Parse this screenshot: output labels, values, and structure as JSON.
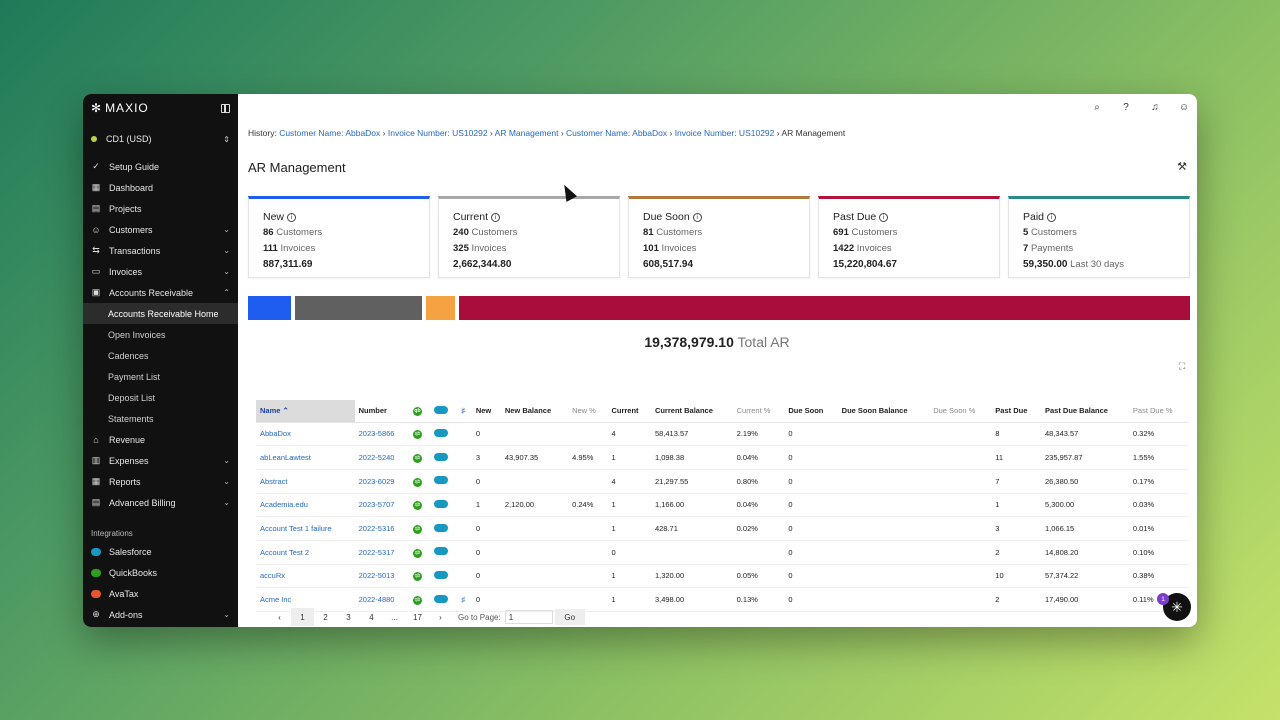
{
  "brand": {
    "name": "MAXIO"
  },
  "entity": {
    "label": "CD1 (USD)"
  },
  "nav": [
    {
      "label": "Setup Guide",
      "icon": "check-circle-icon",
      "chev": ""
    },
    {
      "label": "Dashboard",
      "icon": "dashboard-icon",
      "chev": ""
    },
    {
      "label": "Projects",
      "icon": "folder-icon",
      "chev": ""
    },
    {
      "label": "Customers",
      "icon": "users-icon",
      "chev": "⌄"
    },
    {
      "label": "Transactions",
      "icon": "transactions-icon",
      "chev": "⌄"
    },
    {
      "label": "Invoices",
      "icon": "invoice-icon",
      "chev": "⌄"
    },
    {
      "label": "Accounts Receivable",
      "icon": "wallet-icon",
      "chev": "⌃"
    }
  ],
  "ar_sub": [
    "Accounts Receivable Home",
    "Open Invoices",
    "Cadences",
    "Payment List",
    "Deposit List",
    "Statements"
  ],
  "nav2": [
    {
      "label": "Revenue",
      "icon": "bank-icon",
      "chev": ""
    },
    {
      "label": "Expenses",
      "icon": "expenses-icon",
      "chev": "⌄"
    },
    {
      "label": "Reports",
      "icon": "reports-icon",
      "chev": "⌄"
    },
    {
      "label": "Advanced Billing",
      "icon": "billing-icon",
      "chev": "⌄"
    }
  ],
  "integrations": {
    "label": "Integrations",
    "items": [
      {
        "label": "Salesforce",
        "color": "#1798c1"
      },
      {
        "label": "QuickBooks",
        "color": "#2ca01c"
      },
      {
        "label": "AvaTax",
        "color": "#e8542e"
      }
    ]
  },
  "addons": {
    "label": "Add-ons"
  },
  "history": {
    "label": "History:",
    "links": [
      "Customer Name: AbbaDox",
      "Invoice Number: US10292",
      "AR Management",
      "Customer Name: AbbaDox",
      "Invoice Number: US10292"
    ],
    "current": "AR Management"
  },
  "page": {
    "title": "AR Management"
  },
  "cards": [
    {
      "title": "New",
      "color": "#1f5cf0",
      "count1": "86",
      "label1": "Customers",
      "count2": "111",
      "label2": "Invoices",
      "amount": "887,311.69",
      "note": ""
    },
    {
      "title": "Current",
      "color": "#a8a8a8",
      "count1": "240",
      "label1": "Customers",
      "count2": "325",
      "label2": "Invoices",
      "amount": "2,662,344.80",
      "note": ""
    },
    {
      "title": "Due Soon",
      "color": "#b07a3a",
      "count1": "81",
      "label1": "Customers",
      "count2": "101",
      "label2": "Invoices",
      "amount": "608,517.94",
      "note": ""
    },
    {
      "title": "Past Due",
      "color": "#b0123a",
      "count1": "691",
      "label1": "Customers",
      "count2": "1422",
      "label2": "Invoices",
      "amount": "15,220,804.67",
      "note": ""
    },
    {
      "title": "Paid",
      "color": "#2a8a8a",
      "count1": "5",
      "label1": "Customers",
      "count2": "7",
      "label2": "Payments",
      "amount": "59,350.00",
      "note": "Last 30 days"
    }
  ],
  "bar": [
    {
      "name": "New",
      "color": "#1f5cf0",
      "share": 0.046
    },
    {
      "name": "Current",
      "color": "#606060",
      "share": 0.137
    },
    {
      "name": "Due Soon",
      "color": "#f5a342",
      "share": 0.031
    },
    {
      "name": "Past Due",
      "color": "#a80d3c",
      "share": 0.786
    }
  ],
  "total": {
    "amount": "19,378,979.10",
    "label": "Total AR"
  },
  "table": {
    "headers": [
      "Name ⌃",
      "Number",
      "",
      "",
      "",
      "New",
      "New Balance",
      "New %",
      "Current",
      "Current Balance",
      "Current %",
      "Due Soon",
      "Due Soon Balance",
      "Due Soon %",
      "Past Due",
      "Past Due Balance",
      "Past Due %"
    ],
    "rows": [
      [
        "AbbaDox",
        "2023-5866",
        "0",
        "",
        "",
        "4",
        "58,413.57",
        "2.19%",
        "0",
        "",
        "",
        "8",
        "48,343.57",
        "0.32%",
        ""
      ],
      [
        "abLeanLawtest",
        "2022-5240",
        "3",
        "43,907.35",
        "4.95%",
        "1",
        "1,098.38",
        "0.04%",
        "0",
        "",
        "",
        "11",
        "235,957.87",
        "1.55%",
        ""
      ],
      [
        "Abstract",
        "2023-6029",
        "0",
        "",
        "",
        "4",
        "21,297.55",
        "0.80%",
        "0",
        "",
        "",
        "7",
        "26,380.50",
        "0.17%",
        ""
      ],
      [
        "Academia.edu",
        "2023-5707",
        "1",
        "2,120.00",
        "0.24%",
        "1",
        "1,166.00",
        "0.04%",
        "0",
        "",
        "",
        "1",
        "5,300.00",
        "0.03%",
        ""
      ],
      [
        "Account Test 1 failure",
        "2022-5316",
        "0",
        "",
        "",
        "1",
        "428.71",
        "0.02%",
        "0",
        "",
        "",
        "3",
        "1,066.15",
        "0.01%",
        ""
      ],
      [
        "Account Test 2",
        "2022-5317",
        "0",
        "",
        "",
        "0",
        "",
        "",
        "0",
        "",
        "",
        "2",
        "14,808.20",
        "0.10%",
        ""
      ],
      [
        "accuRx",
        "2022-5013",
        "0",
        "",
        "",
        "1",
        "1,320.00",
        "0.05%",
        "0",
        "",
        "",
        "10",
        "57,374.22",
        "0.38%",
        ""
      ],
      [
        "Acme Inc",
        "2022-4880",
        "0",
        "",
        "",
        "1",
        "3,498.00",
        "0.13%",
        "0",
        "",
        "",
        "2",
        "17,490.00",
        "0.11%",
        "♯"
      ]
    ]
  },
  "pager": {
    "prev": "‹",
    "pages": [
      "1",
      "2",
      "3",
      "4",
      "...",
      "17"
    ],
    "next": "›",
    "goto_label": "Go to Page:",
    "goto_value": "1",
    "go": "Go"
  },
  "chat": {
    "badge": "1"
  }
}
